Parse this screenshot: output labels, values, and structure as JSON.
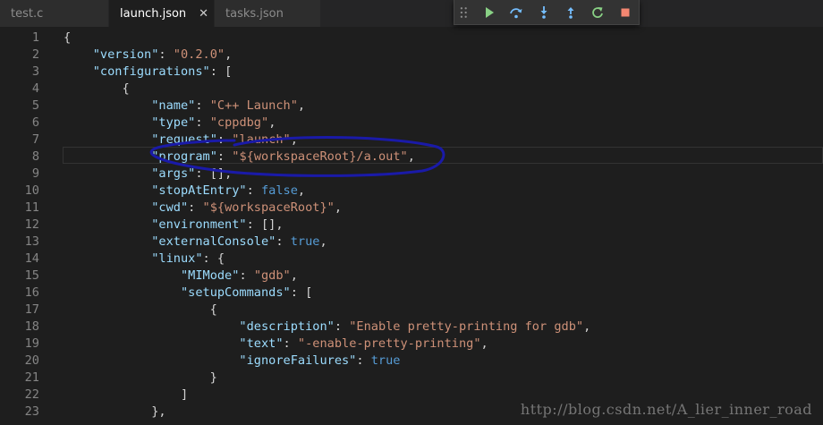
{
  "tabs": [
    {
      "label": "test.c",
      "active": false
    },
    {
      "label": "launch.json",
      "active": true,
      "close": "✕"
    },
    {
      "label": "tasks.json",
      "active": false
    }
  ],
  "debug_toolbar": {
    "buttons": [
      "continue-icon",
      "step-over-icon",
      "step-into-icon",
      "step-out-icon",
      "restart-icon",
      "stop-icon"
    ],
    "colors": {
      "continue": "#89d185",
      "step": "#75beff",
      "restart": "#89d185",
      "stop": "#f48771"
    }
  },
  "editor": {
    "lines": [
      {
        "n": "1",
        "tokens": [
          [
            "p",
            "{"
          ]
        ]
      },
      {
        "n": "2",
        "tokens": [
          [
            "p",
            "    "
          ],
          [
            "k",
            "\"version\""
          ],
          [
            "p",
            ": "
          ],
          [
            "s",
            "\"0.2.0\""
          ],
          [
            "p",
            ","
          ]
        ]
      },
      {
        "n": "3",
        "tokens": [
          [
            "p",
            "    "
          ],
          [
            "k",
            "\"configurations\""
          ],
          [
            "p",
            ": ["
          ]
        ]
      },
      {
        "n": "4",
        "tokens": [
          [
            "p",
            "        {"
          ]
        ]
      },
      {
        "n": "5",
        "tokens": [
          [
            "p",
            "            "
          ],
          [
            "k",
            "\"name\""
          ],
          [
            "p",
            ": "
          ],
          [
            "s",
            "\"C++ Launch\""
          ],
          [
            "p",
            ","
          ]
        ]
      },
      {
        "n": "6",
        "tokens": [
          [
            "p",
            "            "
          ],
          [
            "k",
            "\"type\""
          ],
          [
            "p",
            ": "
          ],
          [
            "s",
            "\"cppdbg\""
          ],
          [
            "p",
            ","
          ]
        ]
      },
      {
        "n": "7",
        "tokens": [
          [
            "p",
            "            "
          ],
          [
            "k",
            "\"request\""
          ],
          [
            "p",
            ": "
          ],
          [
            "s",
            "\"launch\""
          ],
          [
            "p",
            ","
          ]
        ]
      },
      {
        "n": "8",
        "tokens": [
          [
            "p",
            "            "
          ],
          [
            "k",
            "\"program\""
          ],
          [
            "p",
            ": "
          ],
          [
            "s",
            "\"${workspaceRoot}/a.out\""
          ],
          [
            "p",
            ","
          ]
        ]
      },
      {
        "n": "9",
        "tokens": [
          [
            "p",
            "            "
          ],
          [
            "k",
            "\"args\""
          ],
          [
            "p",
            ": [],"
          ]
        ]
      },
      {
        "n": "10",
        "tokens": [
          [
            "p",
            "            "
          ],
          [
            "k",
            "\"stopAtEntry\""
          ],
          [
            "p",
            ": "
          ],
          [
            "b",
            "false"
          ],
          [
            "p",
            ","
          ]
        ]
      },
      {
        "n": "11",
        "tokens": [
          [
            "p",
            "            "
          ],
          [
            "k",
            "\"cwd\""
          ],
          [
            "p",
            ": "
          ],
          [
            "s",
            "\"${workspaceRoot}\""
          ],
          [
            "p",
            ","
          ]
        ]
      },
      {
        "n": "12",
        "tokens": [
          [
            "p",
            "            "
          ],
          [
            "k",
            "\"environment\""
          ],
          [
            "p",
            ": [],"
          ]
        ]
      },
      {
        "n": "13",
        "tokens": [
          [
            "p",
            "            "
          ],
          [
            "k",
            "\"externalConsole\""
          ],
          [
            "p",
            ": "
          ],
          [
            "b",
            "true"
          ],
          [
            "p",
            ","
          ]
        ]
      },
      {
        "n": "14",
        "tokens": [
          [
            "p",
            "            "
          ],
          [
            "k",
            "\"linux\""
          ],
          [
            "p",
            ": {"
          ]
        ]
      },
      {
        "n": "15",
        "tokens": [
          [
            "p",
            "                "
          ],
          [
            "k",
            "\"MIMode\""
          ],
          [
            "p",
            ": "
          ],
          [
            "s",
            "\"gdb\""
          ],
          [
            "p",
            ","
          ]
        ]
      },
      {
        "n": "16",
        "tokens": [
          [
            "p",
            "                "
          ],
          [
            "k",
            "\"setupCommands\""
          ],
          [
            "p",
            ": ["
          ]
        ]
      },
      {
        "n": "17",
        "tokens": [
          [
            "p",
            "                    {"
          ]
        ]
      },
      {
        "n": "18",
        "tokens": [
          [
            "p",
            "                        "
          ],
          [
            "k",
            "\"description\""
          ],
          [
            "p",
            ": "
          ],
          [
            "s",
            "\"Enable pretty-printing for gdb\""
          ],
          [
            "p",
            ","
          ]
        ]
      },
      {
        "n": "19",
        "tokens": [
          [
            "p",
            "                        "
          ],
          [
            "k",
            "\"text\""
          ],
          [
            "p",
            ": "
          ],
          [
            "s",
            "\"-enable-pretty-printing\""
          ],
          [
            "p",
            ","
          ]
        ]
      },
      {
        "n": "20",
        "tokens": [
          [
            "p",
            "                        "
          ],
          [
            "k",
            "\"ignoreFailures\""
          ],
          [
            "p",
            ": "
          ],
          [
            "b",
            "true"
          ]
        ]
      },
      {
        "n": "21",
        "tokens": [
          [
            "p",
            "                    }"
          ]
        ]
      },
      {
        "n": "22",
        "tokens": [
          [
            "p",
            "                ]"
          ]
        ]
      },
      {
        "n": "23",
        "tokens": [
          [
            "p",
            "            },"
          ]
        ]
      }
    ]
  },
  "watermark": "http://blog.csdn.net/A_lier_inner_road"
}
